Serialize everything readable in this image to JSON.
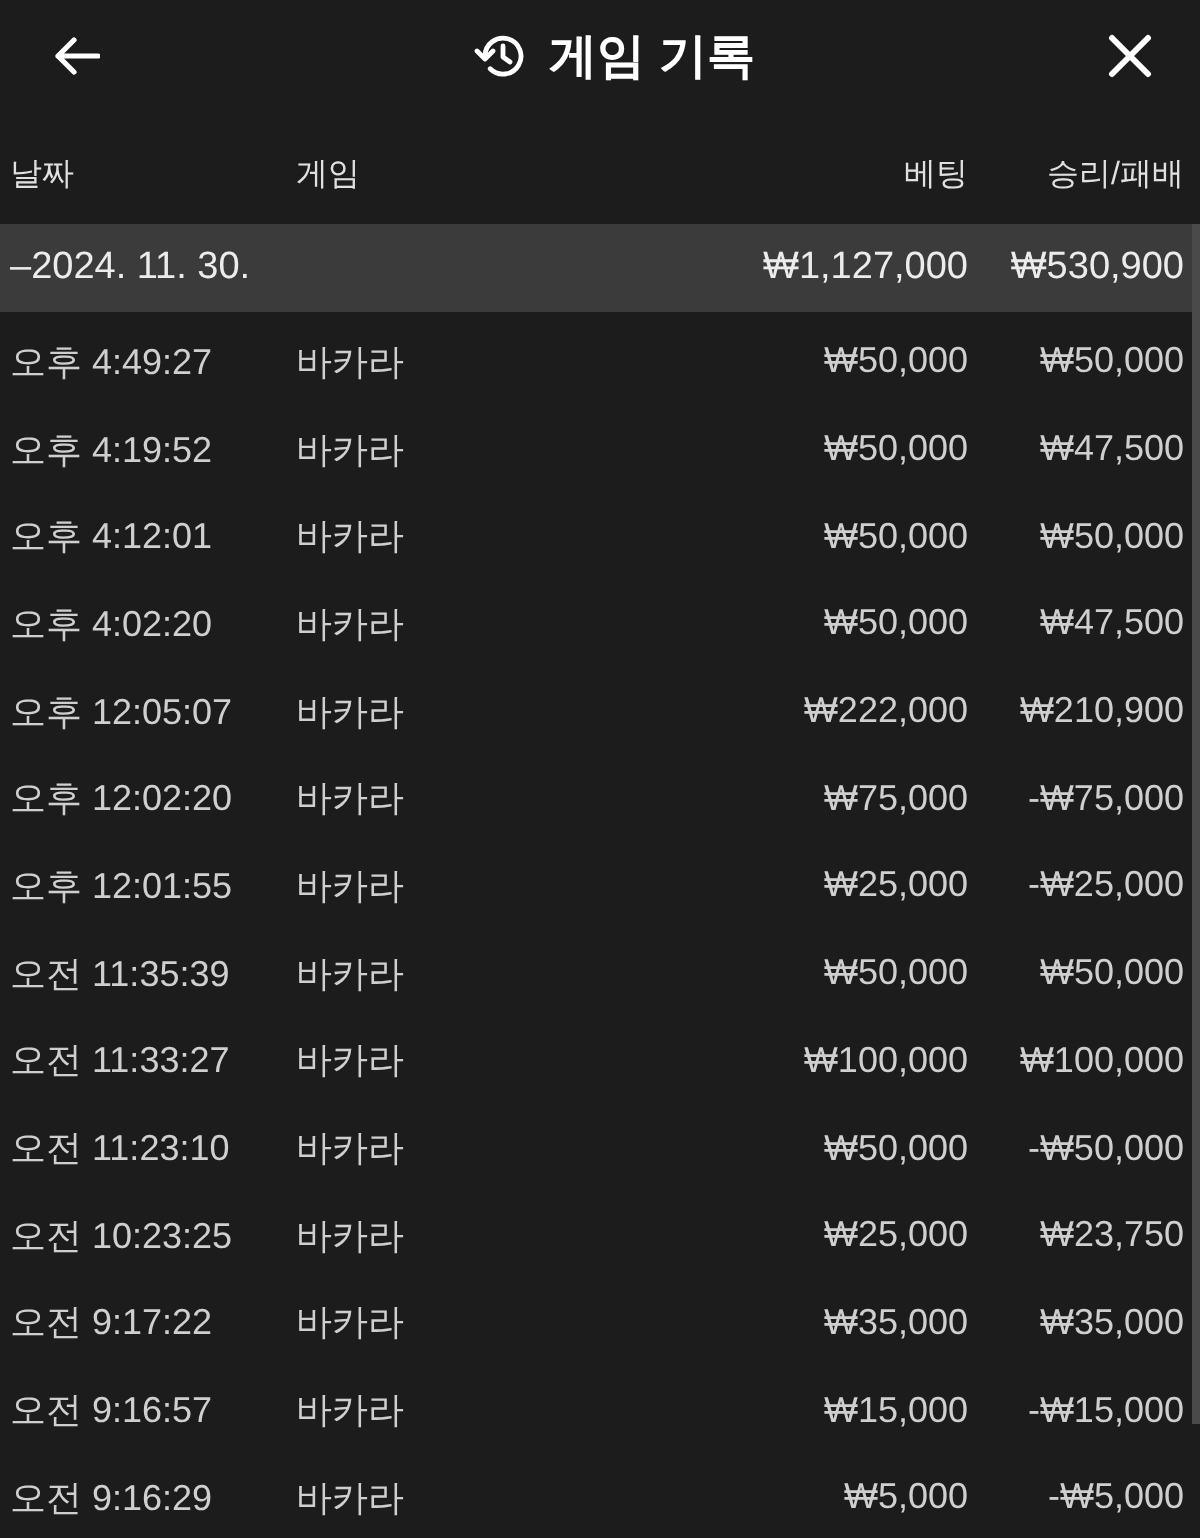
{
  "header": {
    "title": "게임 기록"
  },
  "table": {
    "columns": [
      "날짜",
      "게임",
      "베팅",
      "승리/패배"
    ],
    "groups": [
      {
        "date": "–2024. 11. 30.",
        "bet": "₩1,127,000",
        "result": "₩530,900",
        "rows": [
          {
            "time": "오후 4:49:27",
            "game": "바카라",
            "bet": "₩50,000",
            "result": "₩50,000"
          },
          {
            "time": "오후 4:19:52",
            "game": "바카라",
            "bet": "₩50,000",
            "result": "₩47,500"
          },
          {
            "time": "오후 4:12:01",
            "game": "바카라",
            "bet": "₩50,000",
            "result": "₩50,000"
          },
          {
            "time": "오후 4:02:20",
            "game": "바카라",
            "bet": "₩50,000",
            "result": "₩47,500"
          },
          {
            "time": "오후 12:05:07",
            "game": "바카라",
            "bet": "₩222,000",
            "result": "₩210,900"
          },
          {
            "time": "오후 12:02:20",
            "game": "바카라",
            "bet": "₩75,000",
            "result": "-₩75,000"
          },
          {
            "time": "오후 12:01:55",
            "game": "바카라",
            "bet": "₩25,000",
            "result": "-₩25,000"
          },
          {
            "time": "오전 11:35:39",
            "game": "바카라",
            "bet": "₩50,000",
            "result": "₩50,000"
          },
          {
            "time": "오전 11:33:27",
            "game": "바카라",
            "bet": "₩100,000",
            "result": "₩100,000"
          },
          {
            "time": "오전 11:23:10",
            "game": "바카라",
            "bet": "₩50,000",
            "result": "-₩50,000"
          },
          {
            "time": "오전 10:23:25",
            "game": "바카라",
            "bet": "₩25,000",
            "result": "₩23,750"
          },
          {
            "time": "오전 9:17:22",
            "game": "바카라",
            "bet": "₩35,000",
            "result": "₩35,000"
          },
          {
            "time": "오전 9:16:57",
            "game": "바카라",
            "bet": "₩15,000",
            "result": "-₩15,000"
          },
          {
            "time": "오전 9:16:29",
            "game": "바카라",
            "bet": "₩5,000",
            "result": "-₩5,000"
          }
        ]
      }
    ]
  }
}
